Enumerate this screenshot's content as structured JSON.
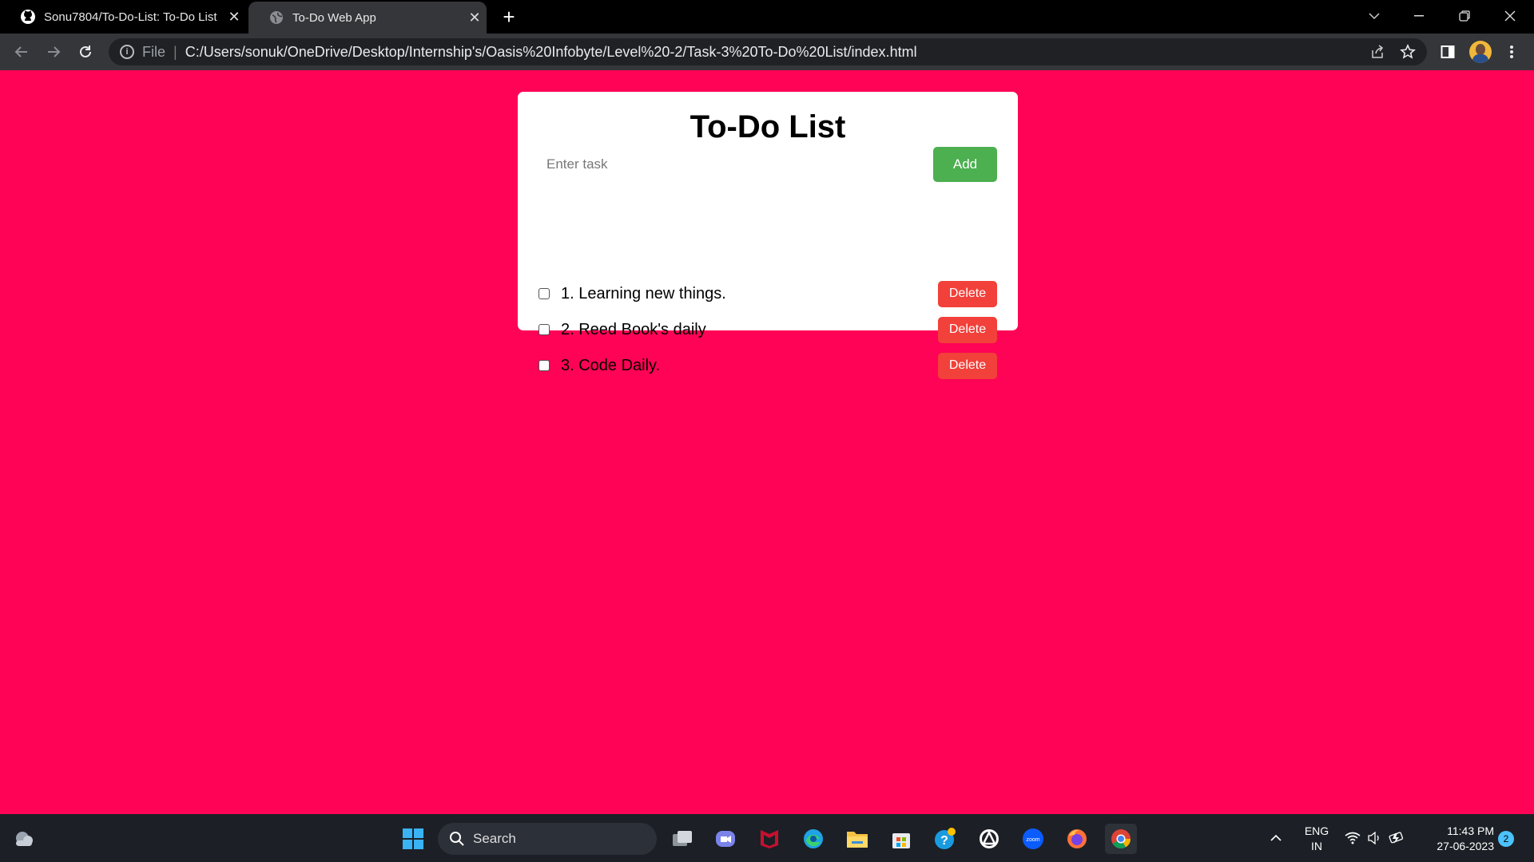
{
  "browser": {
    "tabs": [
      {
        "title": "Sonu7804/To-Do-List: To-Do List",
        "icon": "github-icon",
        "active": false
      },
      {
        "title": "To-Do Web App",
        "icon": "globe-icon",
        "active": true
      }
    ],
    "omnibox": {
      "scheme_label": "File",
      "url": "C:/Users/sonuk/OneDrive/Desktop/Internship's/Oasis%20Infobyte/Level%20-2/Task-3%20To-Do%20List/index.html"
    }
  },
  "page": {
    "background": "#ff0356",
    "title": "To-Do List",
    "input_placeholder": "Enter task",
    "add_label": "Add",
    "tasks": [
      {
        "text": "1. Learning new things.",
        "delete_label": "Delete",
        "checked": false
      },
      {
        "text": "2. Reed Book's daily",
        "delete_label": "Delete",
        "checked": false
      },
      {
        "text": "3. Code Daily.",
        "delete_label": "Delete",
        "checked": false
      }
    ]
  },
  "taskbar": {
    "search_label": "Search",
    "lang_line1": "ENG",
    "lang_line2": "IN",
    "time": "11:43 PM",
    "date": "27-06-2023",
    "notification_count": "2"
  }
}
